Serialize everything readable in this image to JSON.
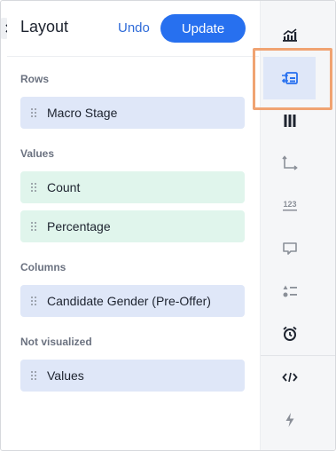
{
  "header": {
    "title": "Layout",
    "undo_label": "Undo",
    "update_label": "Update"
  },
  "sections": {
    "rows": {
      "label": "Rows",
      "items": [
        "Macro Stage"
      ]
    },
    "values": {
      "label": "Values",
      "items": [
        "Count",
        "Percentage"
      ]
    },
    "columns": {
      "label": "Columns",
      "items": [
        "Candidate Gender (Pre-Offer)"
      ]
    },
    "not_visualized": {
      "label": "Not visualized",
      "items": [
        "Values"
      ]
    }
  },
  "toolbar": {
    "items": [
      "chart-icon",
      "layout-swap-icon",
      "columns-icon",
      "axes-icon",
      "number-format-icon",
      "tooltip-icon",
      "conditional-format-icon",
      "alert-timer-icon",
      "code-icon",
      "lightning-icon"
    ],
    "active_item": "layout-swap-icon"
  },
  "colors": {
    "accent": "#2770ef",
    "chip_blue": "#dfe7f8",
    "chip_green": "#e0f5ec",
    "active_outline": "#f0a372"
  }
}
